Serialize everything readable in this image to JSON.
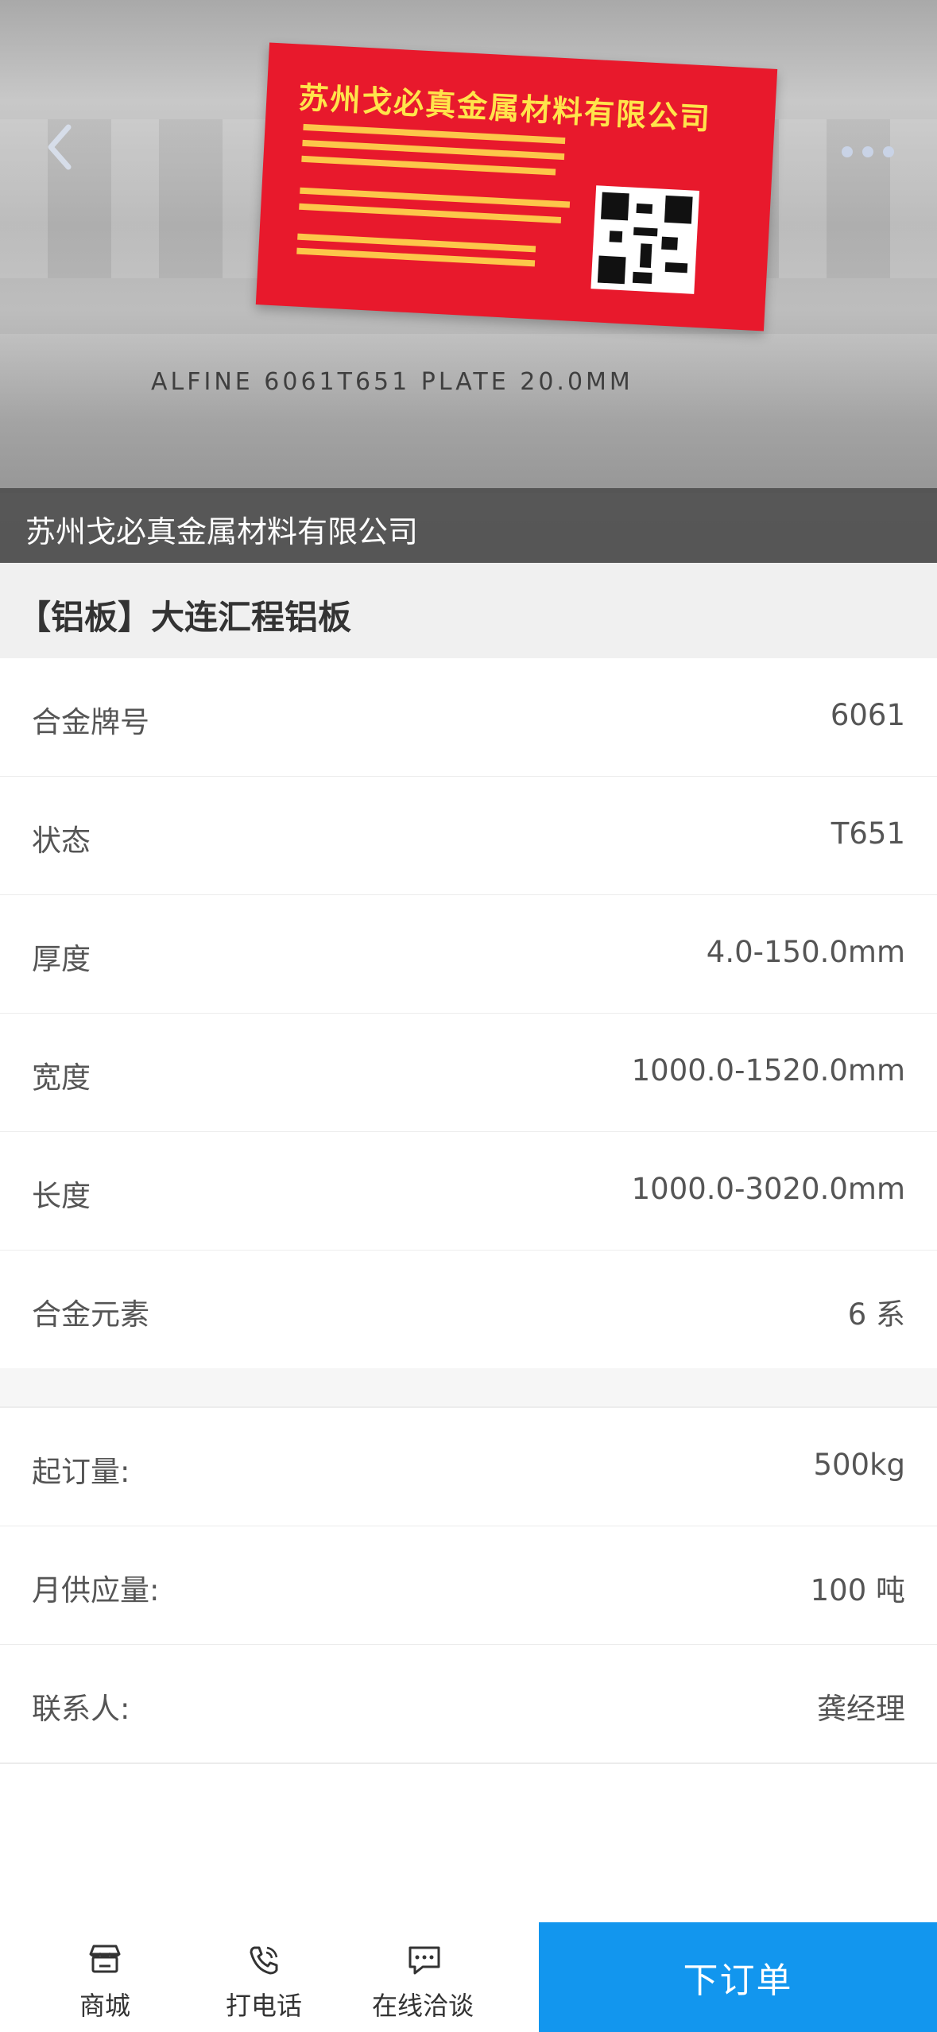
{
  "hero": {
    "card_title": "苏州戈必真金属材料有限公司",
    "engraved_text": "ALFINE 6061T651 PLATE  20.0MM",
    "caption": "苏州戈必真金属材料有限公司"
  },
  "product": {
    "title": "【铝板】大连汇程铝板"
  },
  "specs": [
    {
      "label": "合金牌号",
      "value": "6061"
    },
    {
      "label": "状态",
      "value": "T651"
    },
    {
      "label": "厚度",
      "value": "4.0-150.0mm"
    },
    {
      "label": "宽度",
      "value": "1000.0-1520.0mm"
    },
    {
      "label": "长度",
      "value": "1000.0-3020.0mm"
    },
    {
      "label": "合金元素",
      "value": "6 系"
    }
  ],
  "supply": [
    {
      "label": "起订量:",
      "value": "500kg"
    },
    {
      "label": "月供应量:",
      "value": "100 吨"
    },
    {
      "label": "联系人:",
      "value": "龚经理"
    }
  ],
  "bottom_bar": {
    "tabs": [
      {
        "label": "商城",
        "icon": "store-icon"
      },
      {
        "label": "打电话",
        "icon": "phone-icon"
      },
      {
        "label": "在线洽谈",
        "icon": "chat-icon"
      }
    ],
    "order_label": "下订单",
    "order_color": "#1296ee"
  }
}
